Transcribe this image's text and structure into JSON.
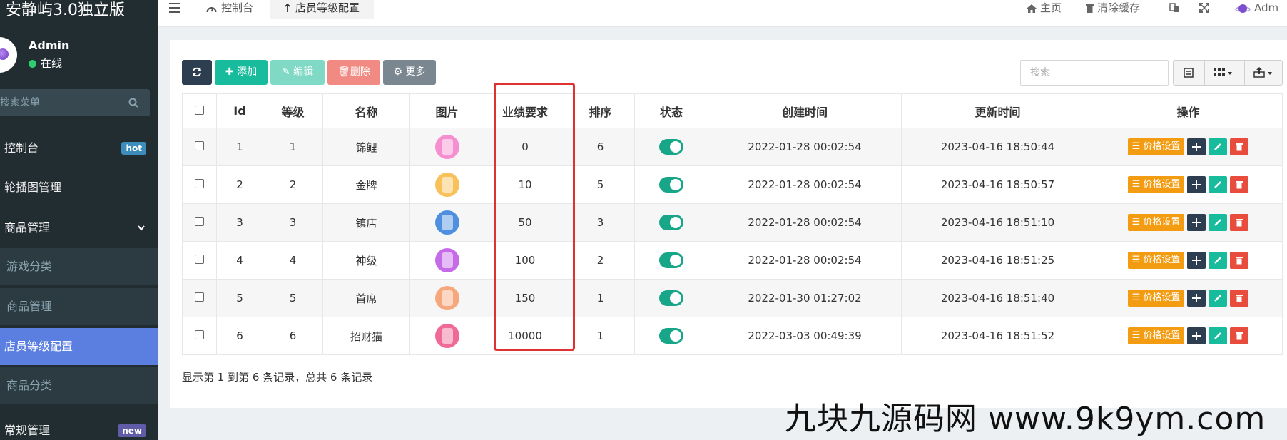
{
  "sidebar": {
    "brand": "安静屿3.0独立版",
    "user": {
      "name": "Admin",
      "status": "在线"
    },
    "search_placeholder": "搜索菜单",
    "items": [
      {
        "label": "控制台",
        "badge": "hot"
      },
      {
        "label": "轮播图管理"
      },
      {
        "label": "商品管理"
      },
      {
        "label": "游戏分类"
      },
      {
        "label": "商品管理"
      },
      {
        "label": "店员等级配置"
      },
      {
        "label": "商品分类"
      },
      {
        "label": "常规管理",
        "badge": "new"
      }
    ]
  },
  "topbar": {
    "tabs": [
      {
        "label": "控制台",
        "icon": "dashboard-icon"
      },
      {
        "label": "店员等级配置",
        "icon": "level-up-icon"
      }
    ],
    "right": {
      "home": "主页",
      "clear_cache": "清除缓存",
      "user": "Adm"
    }
  },
  "toolbar": {
    "add": "添加",
    "edit": "编辑",
    "delete": "删除",
    "more": "更多",
    "search_placeholder": "搜索"
  },
  "table": {
    "headers": [
      "Id",
      "等级",
      "名称",
      "图片",
      "业绩要求",
      "排序",
      "状态",
      "创建时间",
      "更新时间",
      "操作"
    ],
    "price_label": "价格设置",
    "rows": [
      {
        "id": "1",
        "level": "1",
        "name": "锦鲤",
        "requirement": "0",
        "sort": "6",
        "created": "2022-01-28 00:02:54",
        "updated": "2023-04-16 18:50:44",
        "color": "#f58fd0"
      },
      {
        "id": "2",
        "level": "2",
        "name": "金牌",
        "requirement": "10",
        "sort": "5",
        "created": "2022-01-28 00:02:54",
        "updated": "2023-04-16 18:50:57",
        "color": "#f8c15a"
      },
      {
        "id": "3",
        "level": "3",
        "name": "镇店",
        "requirement": "50",
        "sort": "3",
        "created": "2022-01-28 00:02:54",
        "updated": "2023-04-16 18:51:10",
        "color": "#4e8fe0"
      },
      {
        "id": "4",
        "level": "4",
        "name": "神级",
        "requirement": "100",
        "sort": "2",
        "created": "2022-01-28 00:02:54",
        "updated": "2023-04-16 18:51:25",
        "color": "#c66be8"
      },
      {
        "id": "5",
        "level": "5",
        "name": "首席",
        "requirement": "150",
        "sort": "1",
        "created": "2022-01-30 01:27:02",
        "updated": "2023-04-16 18:51:40",
        "color": "#f7a77c"
      },
      {
        "id": "6",
        "level": "6",
        "name": "招财猫",
        "requirement": "10000",
        "sort": "1",
        "created": "2022-03-03 00:49:39",
        "updated": "2023-04-16 18:51:52",
        "color": "#f06a97"
      }
    ]
  },
  "footer": {
    "info": "显示第 1 到第 6 条记录，总共 6 条记录"
  },
  "watermark": "九块九源码网 www.9k9ym.com"
}
